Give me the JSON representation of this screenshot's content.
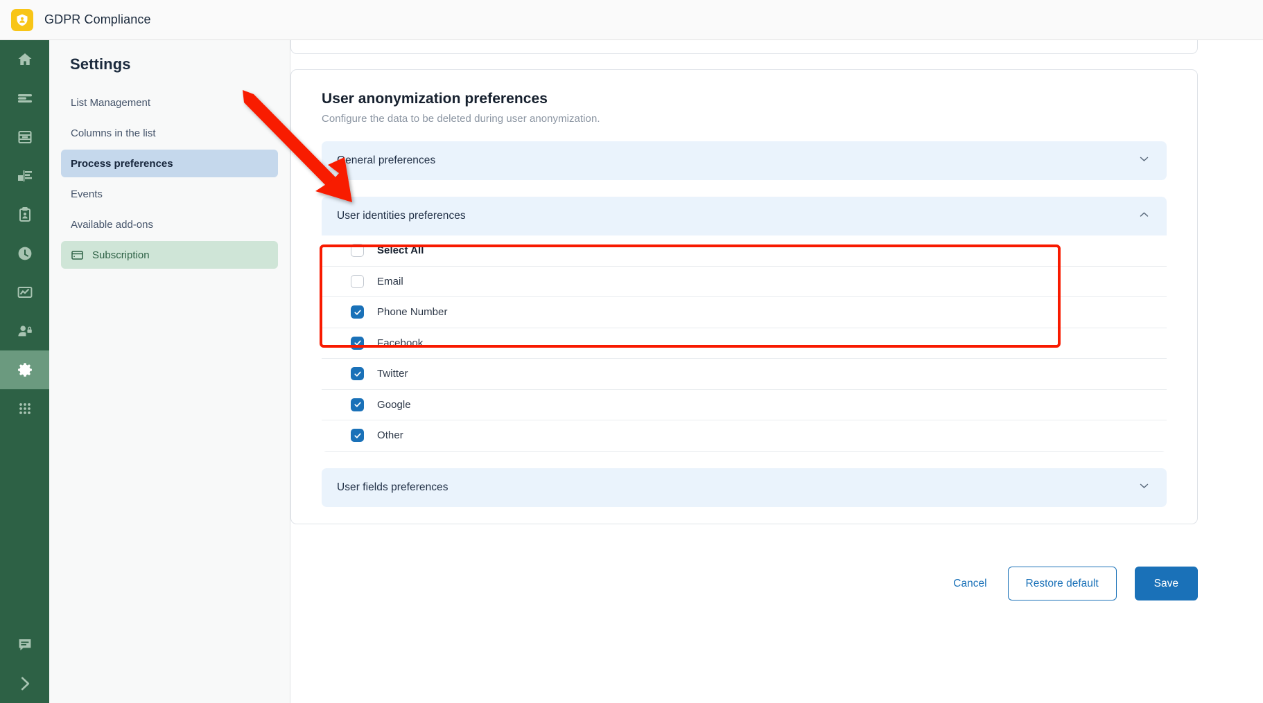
{
  "header": {
    "title": "GDPR Compliance",
    "logo_icon": "shield-user-icon",
    "logo_color": "#f8c517"
  },
  "rail": {
    "background": "#2d6145",
    "active_background": "#6b9a7f",
    "items": [
      {
        "icon": "home-icon",
        "active": false
      },
      {
        "icon": "list-lines-icon",
        "active": false
      },
      {
        "icon": "database-icon",
        "active": false
      },
      {
        "icon": "chart-bar-icon",
        "active": false
      },
      {
        "icon": "clipboard-user-icon",
        "active": false
      },
      {
        "icon": "clock-icon",
        "active": false
      },
      {
        "icon": "trend-chart-icon",
        "active": false
      },
      {
        "icon": "user-lock-icon",
        "active": false
      },
      {
        "icon": "gear-icon",
        "active": true
      },
      {
        "icon": "grid-dots-icon",
        "active": false
      }
    ],
    "bottom_items": [
      {
        "icon": "chat-icon"
      },
      {
        "icon": "chevron-right-icon"
      }
    ]
  },
  "settings": {
    "heading": "Settings",
    "items": [
      {
        "label": "List Management",
        "selected": false,
        "style": "plain"
      },
      {
        "label": "Columns in the list",
        "selected": false,
        "style": "plain"
      },
      {
        "label": "Process preferences",
        "selected": true,
        "style": "plain"
      },
      {
        "label": "Events",
        "selected": false,
        "style": "plain"
      },
      {
        "label": "Available add-ons",
        "selected": false,
        "style": "plain"
      },
      {
        "label": "Subscription",
        "selected": false,
        "style": "green",
        "icon": "credit-card-icon"
      }
    ],
    "selected_background": "#c5d8ec",
    "green_background": "#cfe5d7"
  },
  "main": {
    "title": "User anonymization preferences",
    "subtitle": "Configure the data to be deleted during user anonymization.",
    "accordions": [
      {
        "label": "General preferences",
        "expanded": false,
        "chevron": "chevron-down-icon"
      },
      {
        "label": "User identities preferences",
        "expanded": true,
        "chevron": "chevron-up-icon",
        "highlighted": true
      },
      {
        "label": "User fields preferences",
        "expanded": false,
        "chevron": "chevron-down-icon"
      }
    ],
    "identity_options": [
      {
        "label": "Select All",
        "checked": false,
        "bold": true
      },
      {
        "label": "Email",
        "checked": false,
        "bold": false
      },
      {
        "label": "Phone Number",
        "checked": true,
        "bold": false
      },
      {
        "label": "Facebook",
        "checked": true,
        "bold": false
      },
      {
        "label": "Twitter",
        "checked": true,
        "bold": false
      },
      {
        "label": "Google",
        "checked": true,
        "bold": false
      },
      {
        "label": "Other",
        "checked": true,
        "bold": false
      }
    ],
    "accordion_background": "#eaf3fc",
    "checkbox_checked_color": "#1a71b8"
  },
  "footer": {
    "cancel_label": "Cancel",
    "restore_label": "Restore default",
    "save_label": "Save",
    "primary_color": "#1a71b8"
  },
  "annotation": {
    "arrow_color": "#f81a00",
    "highlight_color": "#f81a00"
  }
}
